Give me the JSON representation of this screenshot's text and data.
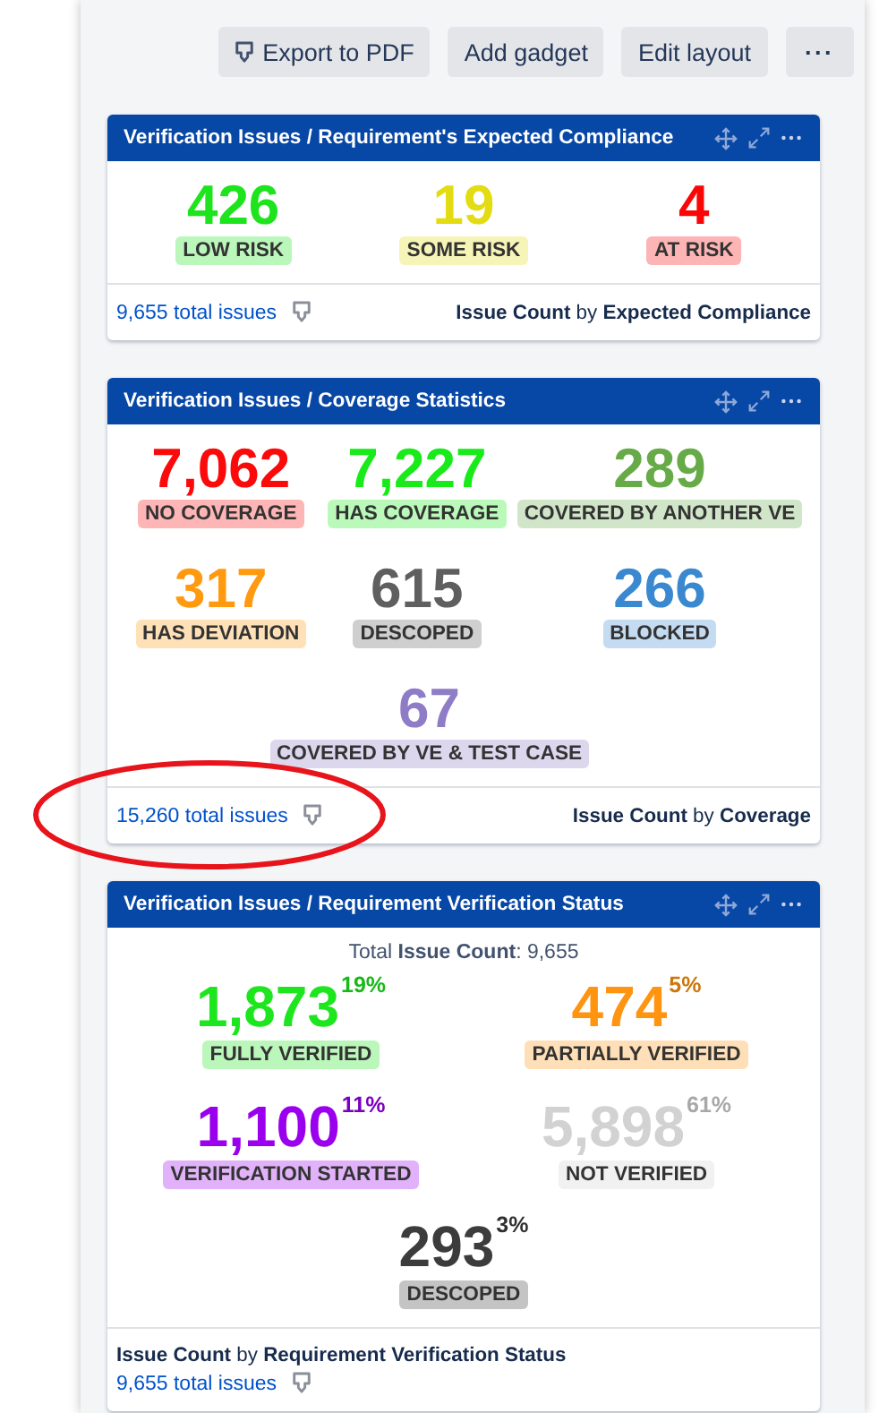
{
  "toolbar": [
    {
      "label": "Export to PDF",
      "kind": "export"
    },
    {
      "label": "Add gadget",
      "kind": "text"
    },
    {
      "label": "Edit layout",
      "kind": "text"
    },
    {
      "label": "···",
      "kind": "more"
    }
  ],
  "gadgets": [
    {
      "kind": "compliance",
      "title": "Verification Issues / Requirement's Expected Compliance",
      "rows": [
        [
          {
            "value": "426",
            "label": "LOW RISK",
            "color": "#1de41d"
          },
          {
            "value": "19",
            "label": "SOME RISK",
            "color": "#e3dc12"
          },
          {
            "value": "4",
            "label": "AT RISK",
            "color": "#fa0606"
          }
        ]
      ],
      "total": "9,655 total issues",
      "circled": false,
      "caption": "**Issue Count** by **Expected Compliance**"
    },
    {
      "kind": "coverage",
      "title": "Verification Issues / Coverage Statistics",
      "rows": [
        [
          {
            "value": "7,062",
            "label": "NO COVERAGE",
            "color": "#fa0a0a"
          },
          {
            "value": "7,227",
            "label": "HAS COVERAGE",
            "color": "#19ea19"
          },
          {
            "value": "289",
            "label": "COVERED BY ANOTHER VE",
            "color": "#67ab48"
          }
        ],
        [
          {
            "value": "317",
            "label": "HAS DEVIATION",
            "color": "#ff9a10"
          },
          {
            "value": "615",
            "label": "DESCOPED",
            "color": "#5f5f5f"
          },
          {
            "value": "266",
            "label": "BLOCKED",
            "color": "#3a88cf"
          }
        ],
        [
          "",
          {
            "value": "67",
            "label": "COVERED BY VE & TEST CASE",
            "color": "#8f7cc6"
          },
          ""
        ]
      ],
      "total": "15,260 total issues",
      "circled": true,
      "caption": "**Issue Count** by **Coverage**"
    },
    {
      "kind": "verification",
      "title": "Verification Issues / Requirement Verification Status",
      "summary": "Total **Issue Count**: 9,655",
      "rows": [
        [
          {
            "value": "1,873",
            "percent": "19%",
            "label": "FULLY VERIFIED",
            "color": "#1ee61e"
          },
          {
            "value": "474",
            "percent": "5%",
            "label": "PARTIALLY VERIFIED",
            "color": "#ff9410"
          }
        ],
        [
          {
            "value": "1,100",
            "percent": "11%",
            "label": "VERIFICATION STARTED",
            "color": "#9a00ee"
          },
          {
            "value": "5,898",
            "percent": "61%",
            "label": "NOT VERIFIED",
            "color": "#d2d2d2"
          }
        ],
        [
          {
            "value": "293",
            "percent": "3%",
            "label": "DESCOPED",
            "color": "#3c3c3c"
          }
        ]
      ],
      "total": "9,655 total issues",
      "circled": false,
      "caption": "**Issue Count** by **Requirement Verification Status**"
    }
  ]
}
